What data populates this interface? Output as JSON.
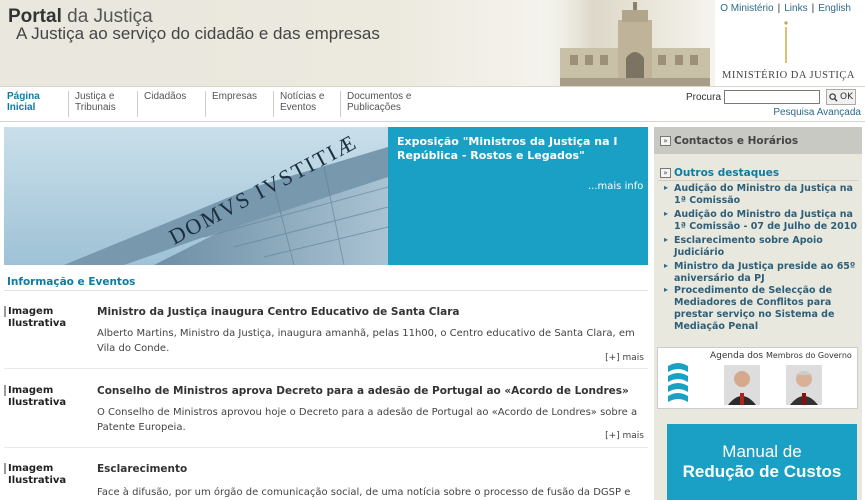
{
  "header": {
    "brand_bold": "Portal",
    "brand_rest": " da Justiça",
    "subtitle": "A Justiça ao serviço do cidadão e das empresas",
    "top_links": [
      "O Ministério",
      "Links",
      "English"
    ],
    "ministry_name": "MINISTÉRIO DA JUSTIÇA"
  },
  "nav": {
    "items": [
      {
        "line1": "Página",
        "line2": "Inicial"
      },
      {
        "line1": "Justiça e",
        "line2": "Tribunais"
      },
      {
        "line1": "Cidadãos",
        "line2": ""
      },
      {
        "line1": "Empresas",
        "line2": ""
      },
      {
        "line1": "Notícias e",
        "line2": "Eventos"
      },
      {
        "line1": "Documentos e",
        "line2": "Publicações"
      }
    ],
    "search_label": "Procura",
    "search_value": "",
    "search_button": "OK",
    "advanced_search": "Pesquisa Avançada"
  },
  "hero": {
    "title": "Exposição \"Ministros da Justiça na I República - Rostos e Legados\"",
    "more": "...mais info",
    "image_text": "DOMVS IVSTITIÆ"
  },
  "news_section": {
    "title": "Informação e Eventos",
    "thumb_alt": "Imagem Ilustrativa",
    "more_label": "[+] mais",
    "items": [
      {
        "title": "Ministro da Justiça inaugura Centro Educativo de Santa Clara",
        "text": "Alberto Martins, Ministro da Justiça, inaugura amanhã, pelas 11h00, o Centro educativo de Santa Clara, em Vila do Conde."
      },
      {
        "title": "Conselho de Ministros aprova Decreto para a adesão de Portugal ao «Acordo de Londres»",
        "text": "O Conselho de Ministros aprovou hoje o Decreto para a adesão de Portugal ao «Acordo de Londres» sobre a Patente Europeia."
      },
      {
        "title": "Esclarecimento",
        "text": "Face à difusão, por um órgão de comunicação social, de uma notícia sobre o processo de fusão da DGSP e DGRS,"
      }
    ]
  },
  "sidebar": {
    "contacts": "Contactos e Horários",
    "outros": "Outros destaques",
    "highlights": [
      "Audição do Ministro da Justiça na 1ª Comissão",
      "Audição do Ministro da Justiça na 1ª Comissão - 07 de Julho de 2010",
      "Esclarecimento sobre Apoio Judiciário",
      "Ministro da Justiça preside ao 65º aniversário da PJ",
      "Procedimento de Selecção de Mediadores de Conflitos para prestar serviço no Sistema de Mediação Penal"
    ],
    "agenda_title_a": "Agenda dos",
    "agenda_title_b": "Membros do Governo",
    "manual_line1": "Manual de",
    "manual_line2": "Redução de Custos"
  },
  "colors": {
    "accent": "#0a7da0",
    "hero_bg": "#1aa0c4",
    "sidebar_bg": "#e9e8df"
  }
}
